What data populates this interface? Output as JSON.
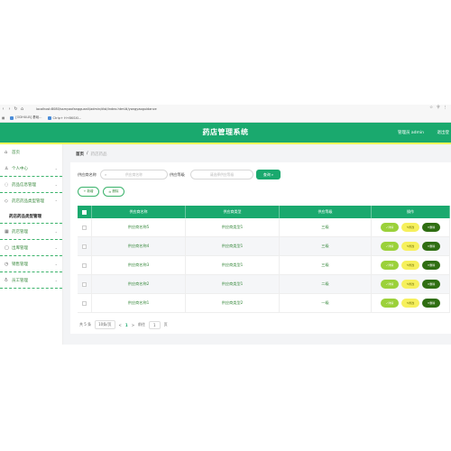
{
  "browser": {
    "url": "localhost:8080/ssmyaofangguanli/admin/dist/index.html#/yongyaoguidance",
    "bookmarks": [
      {
        "label": "[ODHULB] 基础..."
      },
      {
        "label": "Ctrip+ H+BKSXI..."
      }
    ]
  },
  "header": {
    "title": "药店管理系统",
    "user": "管理员 admin",
    "exit": "退出登"
  },
  "sidebar": {
    "items": [
      {
        "label": "首页",
        "icon": "home-icon"
      },
      {
        "label": "个人中心",
        "icon": "user-icon"
      },
      {
        "label": "药品信息管理",
        "icon": "pill-icon"
      },
      {
        "label": "药店药品类型管理",
        "icon": "tag-icon"
      }
    ],
    "sub_item": "药店药品类型管理",
    "items_after": [
      {
        "label": "药店管理",
        "icon": "grid-icon"
      },
      {
        "label": "出库管理",
        "icon": "box-icon"
      },
      {
        "label": "销售管理",
        "icon": "clock-icon"
      },
      {
        "label": "员工管理",
        "icon": "badge-icon"
      }
    ]
  },
  "breadcrumb": {
    "home": "首页",
    "separator": "/",
    "current": "药店药品"
  },
  "filters": {
    "name_label": "供应商名称",
    "name_placeholder": "供应商名称",
    "level_label": "供应等级",
    "level_placeholder": "请选择供应等级",
    "query_button": "查询"
  },
  "actions": {
    "add": "+ 新增",
    "delete": "删除"
  },
  "table": {
    "headers": [
      "供应商名称",
      "供应商类型",
      "供应等级",
      "操作"
    ],
    "rows": [
      [
        "供应商名称5",
        "供应商类型1",
        "三级"
      ],
      [
        "供应商名称4",
        "供应商类型1",
        "三级"
      ],
      [
        "供应商名称3",
        "供应商类型1",
        "三级"
      ],
      [
        "供应商名称2",
        "供应商类型1",
        "二级"
      ],
      [
        "供应商名称1",
        "供应商类型2",
        "一级"
      ]
    ],
    "op_labels": {
      "detail": "详情",
      "edit": "修改",
      "delete": "删除"
    }
  },
  "pager": {
    "total": "共 5 条",
    "size": "10条/页",
    "prev": "<",
    "page": "1",
    "next": ">",
    "goto": "前往",
    "jump": "1",
    "unit": "页"
  },
  "colors": {
    "primary": "#1aa96e",
    "accent": "#f1f75a",
    "detail": "#9bd13a",
    "edit": "#f6f05c",
    "delete": "#2f6e12"
  }
}
